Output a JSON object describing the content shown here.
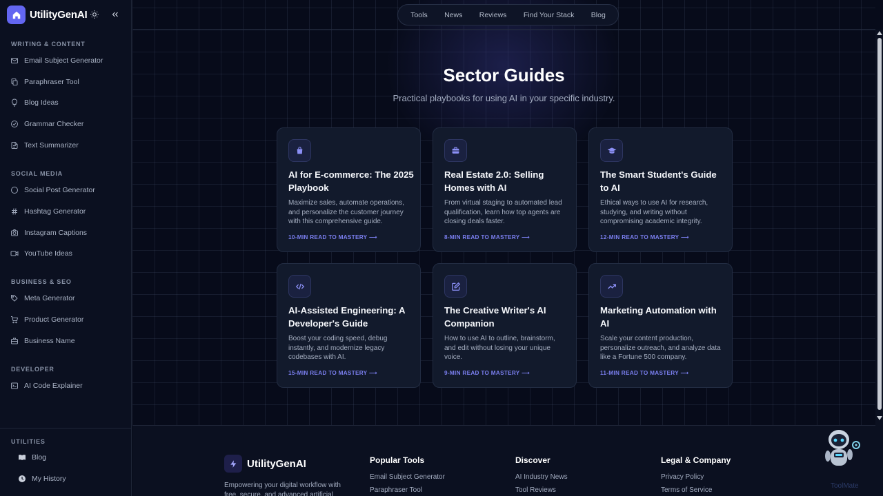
{
  "app": {
    "name": "UtilityGenAI"
  },
  "sidebar": {
    "sections": {
      "writing": "WRITING & CONTENT",
      "social": "SOCIAL MEDIA",
      "business": "BUSINESS & SEO",
      "developer": "DEVELOPER",
      "utilities": "UTILITIES"
    },
    "items": {
      "email": "Email Subject Generator",
      "paraphraser": "Paraphraser Tool",
      "blog_ideas": "Blog Ideas",
      "grammar": "Grammar Checker",
      "summarizer": "Text Summarizer",
      "social_post": "Social Post Generator",
      "hashtag": "Hashtag Generator",
      "instagram": "Instagram Captions",
      "youtube": "YouTube Ideas",
      "meta": "Meta Generator",
      "product": "Product Generator",
      "business_name": "Business Name",
      "code_explainer": "AI Code Explainer",
      "blog": "Blog",
      "history": "My History"
    }
  },
  "topnav": [
    "Tools",
    "News",
    "Reviews",
    "Find Your Stack",
    "Blog"
  ],
  "main": {
    "title": "Sector Guides",
    "subtitle": "Practical playbooks for using AI in your specific industry.",
    "cards": [
      {
        "icon": "shopping-bag-icon",
        "title": "AI for E-commerce: The 2025 Playbook",
        "desc": "Maximize sales, automate operations, and personalize the customer journey with this comprehensive guide.",
        "read": "10-MIN READ TO MASTERY ⟶"
      },
      {
        "icon": "briefcase-icon",
        "title": "Real Estate 2.0: Selling Homes with AI",
        "desc": "From virtual staging to automated lead qualification, learn how top agents are closing deals faster.",
        "read": "8-MIN READ TO MASTERY ⟶"
      },
      {
        "icon": "graduation-cap-icon",
        "title": "The Smart Student's Guide to AI",
        "desc": "Ethical ways to use AI for research, studying, and writing without compromising academic integrity.",
        "read": "12-MIN READ TO MASTERY ⟶"
      },
      {
        "icon": "code-icon",
        "title": "AI-Assisted Engineering: A Developer's Guide",
        "desc": "Boost your coding speed, debug instantly, and modernize legacy codebases with AI.",
        "read": "15-MIN READ TO MASTERY ⟶"
      },
      {
        "icon": "pen-square-icon",
        "title": "The Creative Writer's AI Companion",
        "desc": "How to use AI to outline, brainstorm, and edit without losing your unique voice.",
        "read": "9-MIN READ TO MASTERY ⟶"
      },
      {
        "icon": "trending-up-icon",
        "title": "Marketing Automation with AI",
        "desc": "Scale your content production, personalize outreach, and analyze data like a Fortune 500 company.",
        "read": "11-MIN READ TO MASTERY ⟶"
      }
    ]
  },
  "footer": {
    "brand": "UtilityGenAI",
    "tagline": "Empowering your digital workflow with free, secure, and advanced artificial",
    "popular_tools": {
      "heading": "Popular Tools",
      "links": [
        "Email Subject Generator",
        "Paraphraser Tool"
      ]
    },
    "discover": {
      "heading": "Discover",
      "links": [
        "AI Industry News",
        "Tool Reviews"
      ]
    },
    "legal": {
      "heading": "Legal & Company",
      "links": [
        "Privacy Policy",
        "Terms of Service"
      ]
    }
  },
  "widget": {
    "label": "ToolMate"
  },
  "colors": {
    "accent": "#6366f1",
    "link": "#7b7ff0",
    "bg": "#070b1a",
    "card": "#121a2c"
  }
}
